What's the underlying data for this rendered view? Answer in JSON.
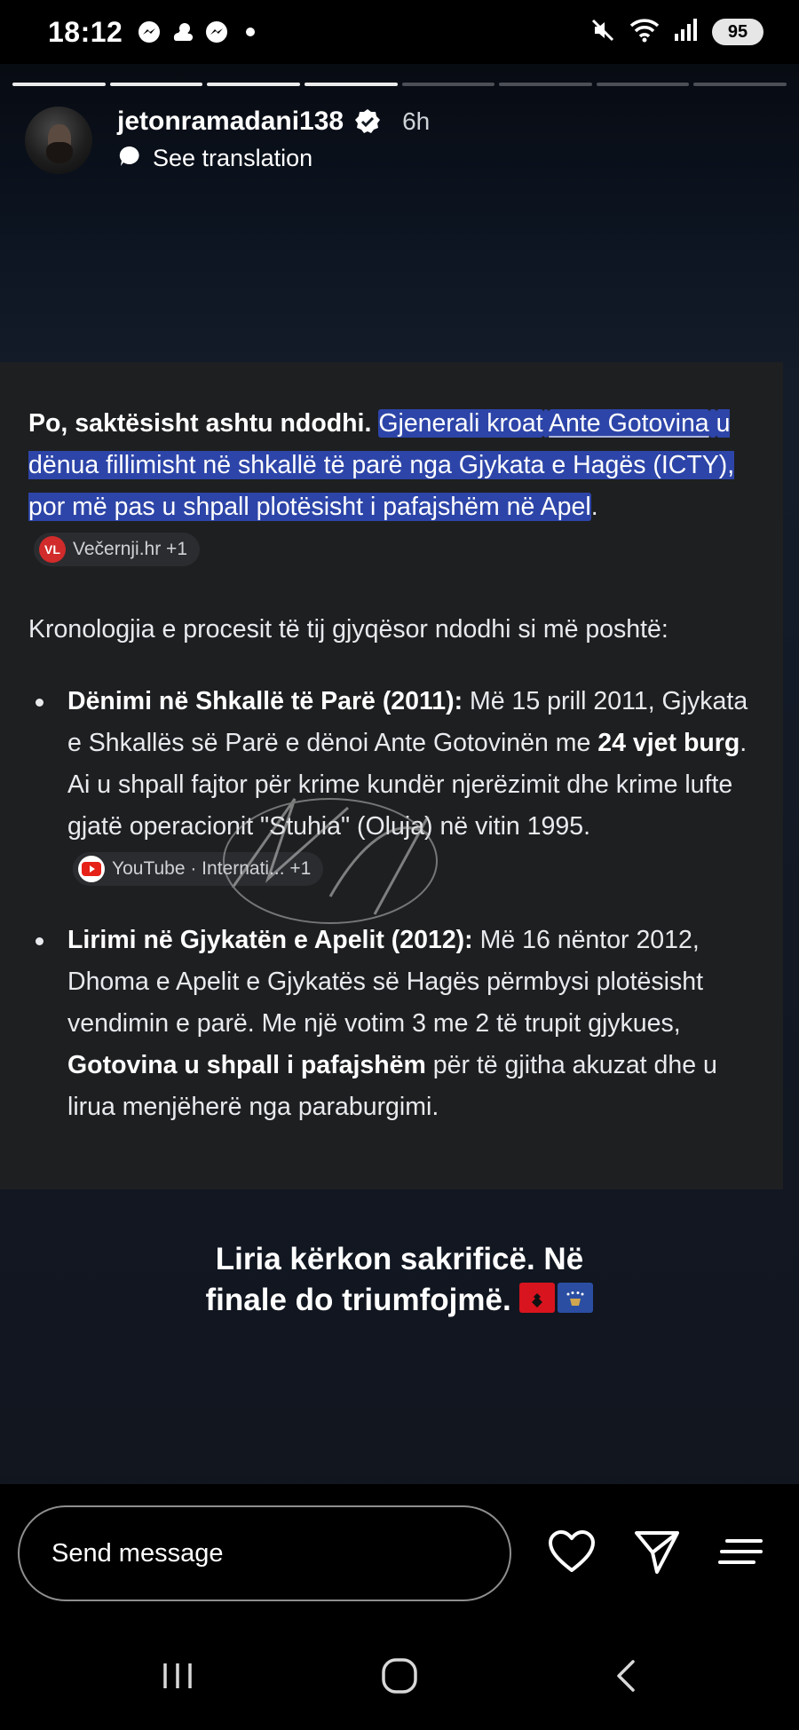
{
  "status_bar": {
    "time": "18:12",
    "battery": "95",
    "left_icons": [
      "messenger-icon",
      "weather-icon",
      "messenger-icon",
      "dot-icon"
    ],
    "right_icons": [
      "mute-icon",
      "wifi-icon",
      "signal-icon"
    ]
  },
  "story": {
    "segments_total": 8,
    "segments_done": 4,
    "username": "jetonramadani138",
    "time_ago": "6h",
    "translate_label": "See translation"
  },
  "card": {
    "lead_bold": "Po, saktësisht ashtu ndodhi.",
    "hl_part1": "Gjenerali kroat",
    "hl_name": "Ante Gotovina",
    "hl_part2": "u dënua fillimisht në shkallë të parë nga Gjykata e Hagës (ICTY), por më pas u shpall plotësisht i pafajshëm në Apel",
    "hl_end": ".",
    "chip1_badge": "VL",
    "chip1_label": "Večernji.hr +1",
    "intro": "Kronologjia e procesit të tij gjyqësor ndodhi si më poshtë:",
    "items": [
      {
        "title": "Dënimi në Shkallë të Parë (2011):",
        "text_before": "Më 15 prill 2011, Gjykata e Shkallës së Parë e dënoi Ante Gotovinën me",
        "bold": "24 vjet burg",
        "text_after": ". Ai u shpall fajtor për krime kundër njerëzimit dhe krime lufte gjatë operacionit \"Stuhia\" (Oluja) në vitin 1995.",
        "chip_label": "YouTube · Internati...  +1"
      },
      {
        "title": "Lirimi në Gjykatën e Apelit (2012):",
        "text_before": "Më 16 nëntor 2012, Dhoma e Apelit e Gjykatës së Hagës përmbysi plotësisht vendimin e parë. Me një votim 3 me 2 të trupit gjykues,",
        "bold": "Gotovina u shpall i pafajshëm",
        "text_after": "për të gjitha akuzat dhe u lirua menjëherë nga paraburgimi."
      }
    ]
  },
  "caption": {
    "line1": "Liria kërkon sakrificë.  Në",
    "line2": "finale do triumfojmë."
  },
  "reply": {
    "placeholder": "Send message"
  },
  "nav": {
    "buttons": [
      "recents-icon",
      "home-icon",
      "back-icon"
    ]
  }
}
